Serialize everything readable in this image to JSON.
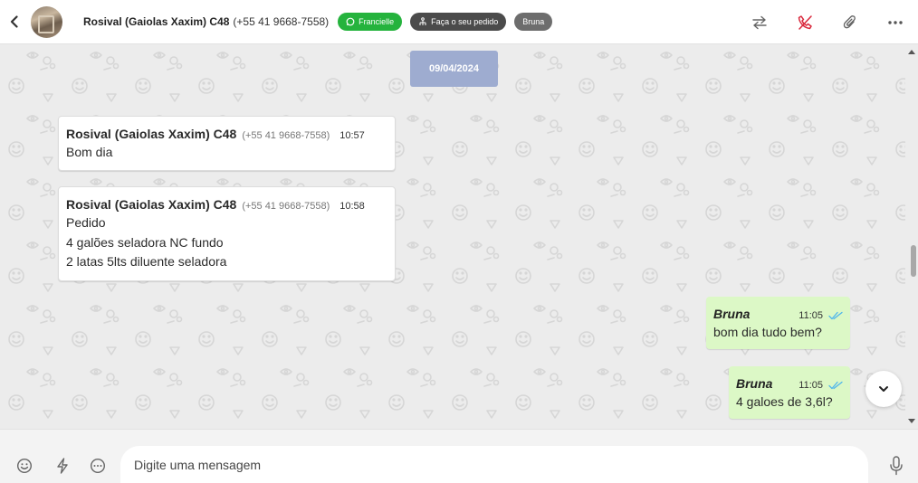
{
  "header": {
    "contact_name": "Rosival (Gaiolas Xaxim) C48",
    "contact_phone": "(+55 41 9668-7558)",
    "tags": [
      {
        "label": "Francielle",
        "color": "#25b33d",
        "icon": "whatsapp-icon"
      },
      {
        "label": "Faça o seu pedido",
        "color": "#4b4b4b",
        "icon": "flow-icon"
      },
      {
        "label": "Bruna",
        "color": "#6d6d6d",
        "icon": ""
      }
    ],
    "actions": [
      "transfer-icon",
      "phone-off-icon",
      "paperclip-icon",
      "more-icon"
    ]
  },
  "chat": {
    "date": "09/04/2024",
    "incoming": [
      {
        "sender": "Rosival (Gaiolas Xaxim) C48",
        "phone": "(+55 41 9668-7558)",
        "time": "10:57",
        "lines": [
          "Bom dia"
        ]
      },
      {
        "sender": "Rosival (Gaiolas Xaxim) C48",
        "phone": "(+55 41 9668-7558)",
        "time": "10:58",
        "lines": [
          "Pedido",
          "4 galões seladora NC fundo",
          "2 latas 5lts diluente seladora"
        ]
      }
    ],
    "outgoing": [
      {
        "sender": "Bruna",
        "time": "11:05",
        "text": "bom dia tudo bem?",
        "status": "read"
      },
      {
        "sender": "Bruna",
        "time": "11:05",
        "text": "4 galoes de 3,6l?",
        "status": "read"
      }
    ]
  },
  "composer": {
    "placeholder": "Digite uma mensagem",
    "icons": [
      "emoji-icon",
      "lightning-icon",
      "chat-dots-icon",
      "microphone-icon"
    ]
  },
  "colors": {
    "accent_green": "#25b33d",
    "outgoing_bubble": "#dcf8c6",
    "date_badge": "#9eacd0",
    "read_ticks": "#4fb6ec",
    "call_end": "#d9283c"
  }
}
